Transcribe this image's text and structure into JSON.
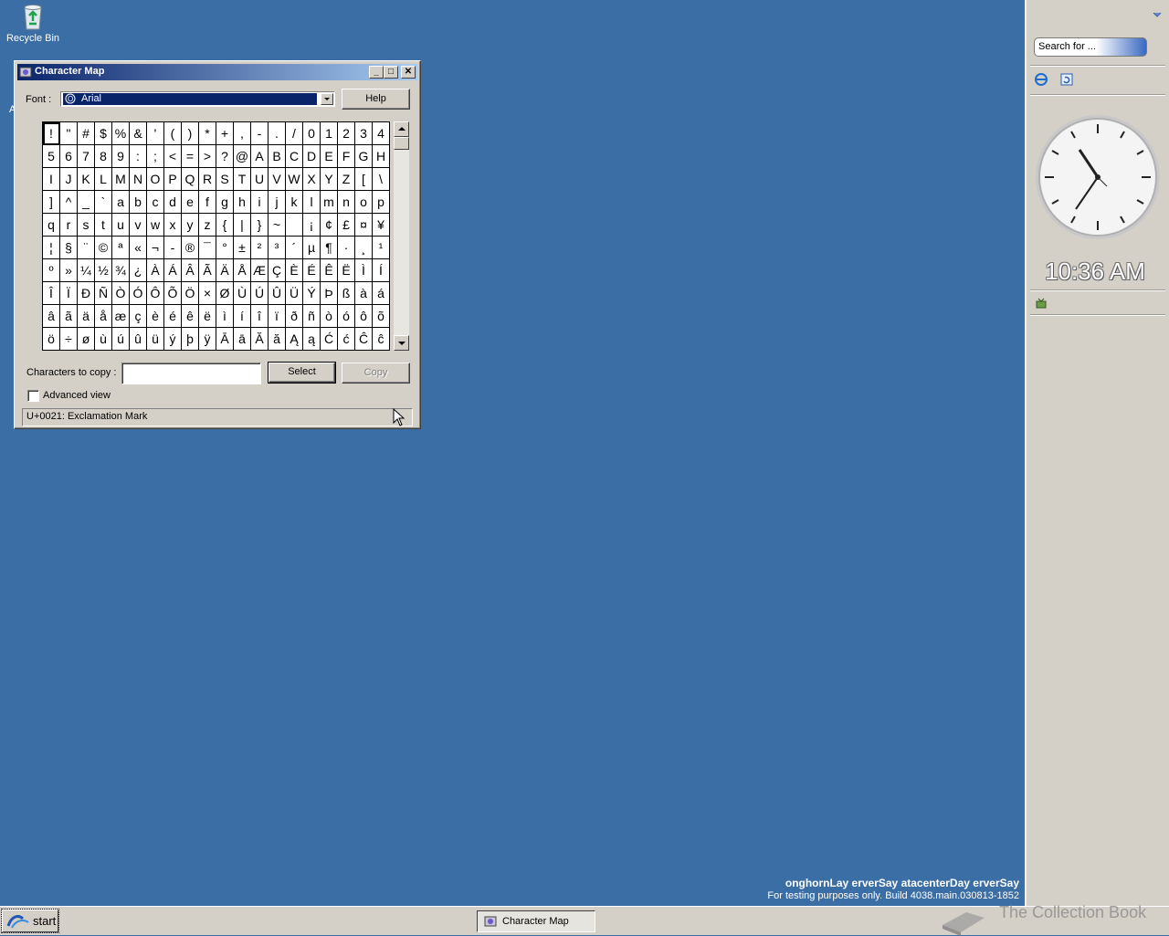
{
  "desktop": {
    "recycle_bin_label": "Recycle Bin",
    "partial_icon_letter": "A"
  },
  "window": {
    "title": "Character Map",
    "font_label": "Font :",
    "font_value": "Arial",
    "help_label": "Help",
    "characters_to_copy_label": "Characters to copy :",
    "characters_to_copy_value": "",
    "select_label": "Select",
    "copy_label": "Copy",
    "advanced_view_label": "Advanced view",
    "advanced_view_checked": false,
    "status_text": "U+0021: Exclamation Mark",
    "selected_index": 0,
    "characters": [
      [
        "!",
        "\"",
        "#",
        "$",
        "%",
        "&",
        "'",
        "(",
        ")",
        "*",
        "+",
        ",",
        "-",
        ".",
        "/",
        "0",
        "1",
        "2",
        "3",
        "4"
      ],
      [
        "5",
        "6",
        "7",
        "8",
        "9",
        ":",
        ";",
        "<",
        "=",
        ">",
        "?",
        "@",
        "A",
        "B",
        "C",
        "D",
        "E",
        "F",
        "G",
        "H"
      ],
      [
        "I",
        "J",
        "K",
        "L",
        "M",
        "N",
        "O",
        "P",
        "Q",
        "R",
        "S",
        "T",
        "U",
        "V",
        "W",
        "X",
        "Y",
        "Z",
        "[",
        "\\"
      ],
      [
        "]",
        "^",
        "_",
        "`",
        "a",
        "b",
        "c",
        "d",
        "e",
        "f",
        "g",
        "h",
        "i",
        "j",
        "k",
        "l",
        "m",
        "n",
        "o",
        "p"
      ],
      [
        "q",
        "r",
        "s",
        "t",
        "u",
        "v",
        "w",
        "x",
        "y",
        "z",
        "{",
        "|",
        "}",
        "~",
        " ",
        "¡",
        "¢",
        "£",
        "¤",
        "¥"
      ],
      [
        "¦",
        "§",
        "¨",
        "©",
        "ª",
        "«",
        "¬",
        "-",
        "®",
        "¯",
        "°",
        "±",
        "²",
        "³",
        "´",
        "µ",
        "¶",
        "·",
        "¸",
        "¹"
      ],
      [
        "º",
        "»",
        "¼",
        "½",
        "¾",
        "¿",
        "À",
        "Á",
        "Â",
        "Ã",
        "Ä",
        "Å",
        "Æ",
        "Ç",
        "È",
        "É",
        "Ê",
        "Ë",
        "Ì",
        "Í"
      ],
      [
        "Î",
        "Ï",
        "Ð",
        "Ñ",
        "Ò",
        "Ó",
        "Ô",
        "Õ",
        "Ö",
        "×",
        "Ø",
        "Ù",
        "Ú",
        "Û",
        "Ü",
        "Ý",
        "Þ",
        "ß",
        "à",
        "á"
      ],
      [
        "â",
        "ã",
        "ä",
        "å",
        "æ",
        "ç",
        "è",
        "é",
        "ê",
        "ë",
        "ì",
        "í",
        "î",
        "ï",
        "ð",
        "ñ",
        "ò",
        "ó",
        "ô",
        "õ"
      ],
      [
        "ö",
        "÷",
        "ø",
        "ù",
        "ú",
        "û",
        "ü",
        "ý",
        "þ",
        "ÿ",
        "Ā",
        "ā",
        "Ă",
        "ă",
        "Ą",
        "ą",
        "Ć",
        "ć",
        "Ĉ",
        "ĉ"
      ]
    ]
  },
  "sidebar": {
    "search_placeholder": "Search for ...",
    "time": "10:36 AM"
  },
  "watermark": {
    "line1": "onghornLay erverSay atacenterDay erverSay",
    "line2": "For testing purposes only. Build 4038.main.030813-1852"
  },
  "taskbar": {
    "start_label": "start",
    "task_label": "Character Map",
    "collection_text": "The Collection Book"
  },
  "colors": {
    "desktop": "#3b6ea5",
    "title_bar": "#0a246a",
    "face": "#d4d0c8"
  }
}
